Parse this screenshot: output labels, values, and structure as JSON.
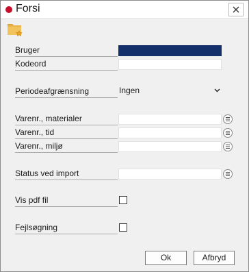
{
  "window": {
    "title": "Forsi"
  },
  "icons": {
    "close": "close-icon",
    "folder": "folder-star-icon",
    "lookup": "list-lookup-icon",
    "dropdown": "chevron-down-icon"
  },
  "colors": {
    "app_dot": "#c8102e",
    "selected_field": "#14306a"
  },
  "form": {
    "user_label": "Bruger",
    "password_label": "Kodeord",
    "period_label": "Periodeafgrænsning",
    "period_value": "Ingen",
    "materials_label": "Varenr., materialer",
    "time_label": "Varenr., tid",
    "environment_label": "Varenr., miljø",
    "import_status_label": "Status ved import",
    "show_pdf_label": "Vis pdf fil",
    "debug_label": "Fejlsøgning"
  },
  "buttons": {
    "ok": "Ok",
    "cancel": "Afbryd"
  }
}
